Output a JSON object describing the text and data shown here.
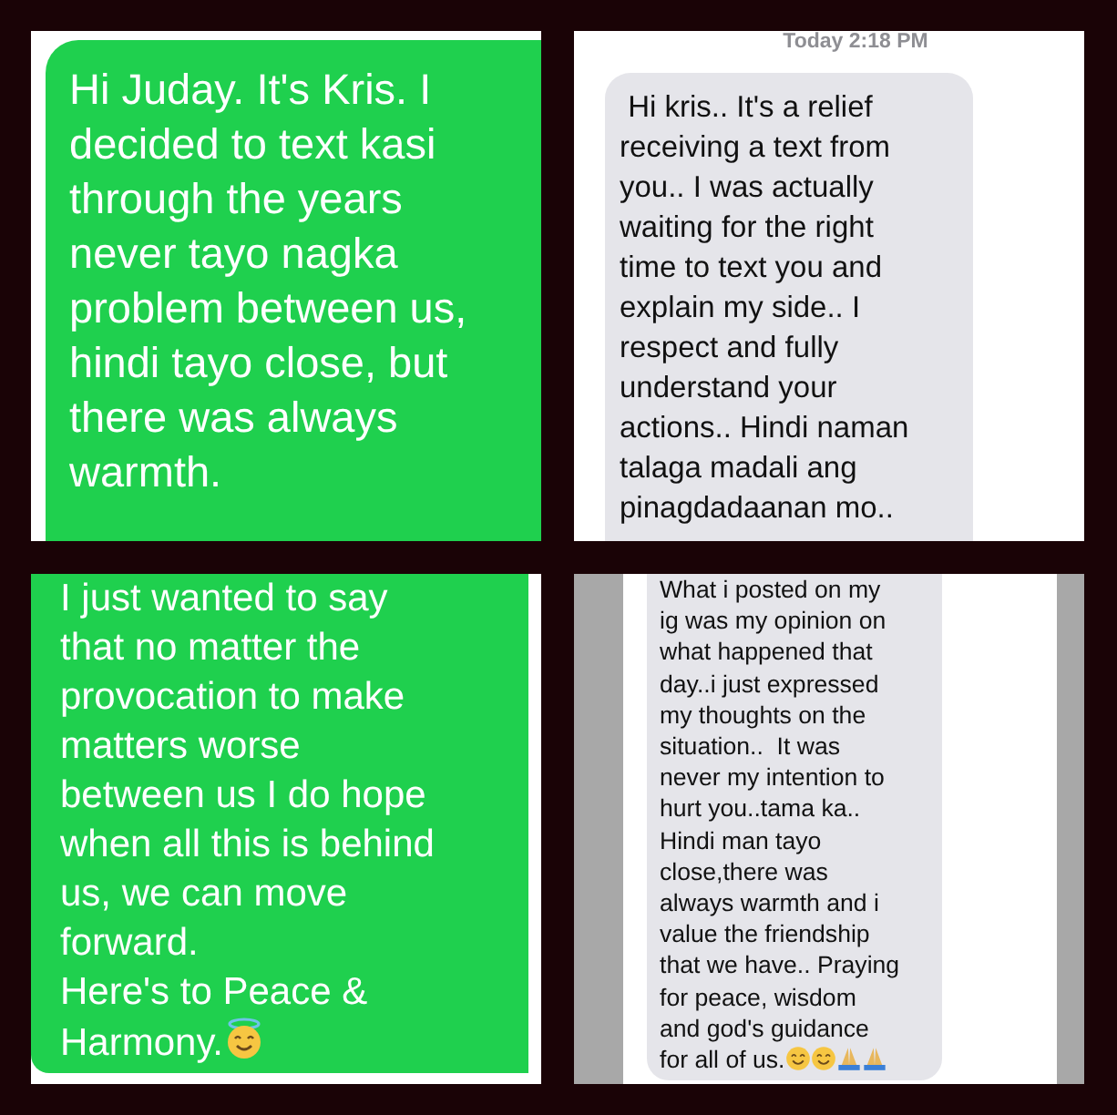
{
  "panels": [
    {
      "kind": "sent",
      "lines": [
        "Hi Juday. It's Kris. I",
        "decided to text kasi",
        "through the years",
        "never tayo nagka",
        "problem between us,",
        "hindi tayo close, but",
        "there was always",
        "warmth."
      ]
    },
    {
      "kind": "received",
      "timestamp": "Today 2:18 PM",
      "lines": [
        " Hi kris.. It's a relief",
        "receiving a text from",
        "you.. I was actually",
        "waiting for the right",
        "time to text you and",
        "explain my side.. I",
        "respect and fully",
        "understand your",
        "actions.. Hindi naman",
        "talaga madali ang",
        "pinagdadaanan mo.."
      ]
    },
    {
      "kind": "sent",
      "lines": [
        "I just wanted to say",
        "that no matter the",
        "provocation to make",
        "matters worse",
        "between us I do hope",
        "when all this is behind",
        "us, we can move",
        "forward.",
        "Here's to Peace &",
        "Harmony."
      ],
      "emoji": [
        {
          "kind": "halo"
        }
      ]
    },
    {
      "kind": "received",
      "lines": [
        "What i posted on my",
        "ig was my opinion on",
        "what happened that",
        "day..i just expressed",
        "my thoughts on the",
        "situation..  It was",
        "never my intention to",
        "hurt you..tama ka..",
        "Hindi man tayo",
        "close,there was",
        "always warmth and i",
        "value the friendship",
        "that we have.. Praying",
        "for peace, wisdom",
        "and god's guidance",
        "for all of us."
      ],
      "emoji": [
        {
          "kind": "smile"
        },
        {
          "kind": "smile"
        },
        {
          "kind": "pray"
        },
        {
          "kind": "pray"
        }
      ]
    }
  ]
}
